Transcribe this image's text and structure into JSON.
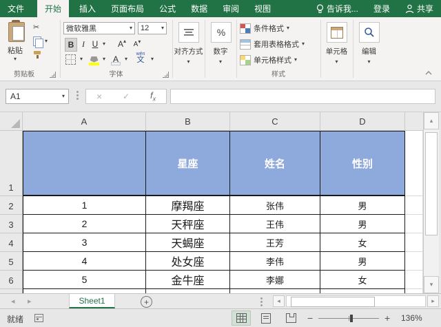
{
  "tabs": {
    "file": "文件",
    "home": "开始",
    "insert": "插入",
    "layout": "页面布局",
    "formulas": "公式",
    "data": "数据",
    "review": "审阅",
    "view": "视图",
    "tell_me": "告诉我...",
    "sign_in": "登录",
    "share": "共享"
  },
  "ribbon": {
    "clipboard": {
      "paste": "粘贴",
      "label": "剪贴板"
    },
    "font": {
      "family": "微软雅黑",
      "size": "12",
      "bold": "B",
      "italic": "I",
      "underline": "U",
      "grow": "A",
      "shrink": "A",
      "color_letter": "A",
      "phonetic_ruby": "wén",
      "phonetic_base": "文",
      "label": "字体"
    },
    "alignment": {
      "label": "对齐方式"
    },
    "number": {
      "label": "数字",
      "percent": "%"
    },
    "styles": {
      "conditional": "条件格式",
      "format_table": "套用表格格式",
      "cell_styles": "单元格样式",
      "label": "样式"
    },
    "cells": {
      "label": "单元格"
    },
    "editing": {
      "label": "编辑"
    }
  },
  "formula_bar": {
    "name_box": "A1",
    "cancel": "×",
    "enter": "✓",
    "fx_f": "f",
    "fx_x": "x"
  },
  "grid": {
    "col_letters": [
      "A",
      "B",
      "C",
      "D"
    ],
    "rows": [
      {
        "n": "1",
        "cells": [
          "",
          "星座",
          "姓名",
          "性别"
        ]
      },
      {
        "n": "2",
        "cells": [
          "1",
          "摩羯座",
          "张伟",
          "男"
        ]
      },
      {
        "n": "3",
        "cells": [
          "2",
          "天秤座",
          "王伟",
          "男"
        ]
      },
      {
        "n": "4",
        "cells": [
          "3",
          "天蝎座",
          "王芳",
          "女"
        ]
      },
      {
        "n": "5",
        "cells": [
          "4",
          "处女座",
          "李伟",
          "男"
        ]
      },
      {
        "n": "6",
        "cells": [
          "5",
          "金牛座",
          "李娜",
          "女"
        ]
      }
    ]
  },
  "sheet_bar": {
    "tab": "Sheet1",
    "add": "+"
  },
  "status_bar": {
    "ready": "就绪",
    "zoom_level": "136%",
    "minus": "−",
    "plus": "+"
  },
  "icons": {
    "dropdown": "▾",
    "up": "▴",
    "down": "▾",
    "left": "◂",
    "right": "▸",
    "scissors": "✂"
  },
  "colors": {
    "excel_green": "#217346",
    "header_fill": "#8EA9DB",
    "fill_yellow": "#FFFF00"
  }
}
